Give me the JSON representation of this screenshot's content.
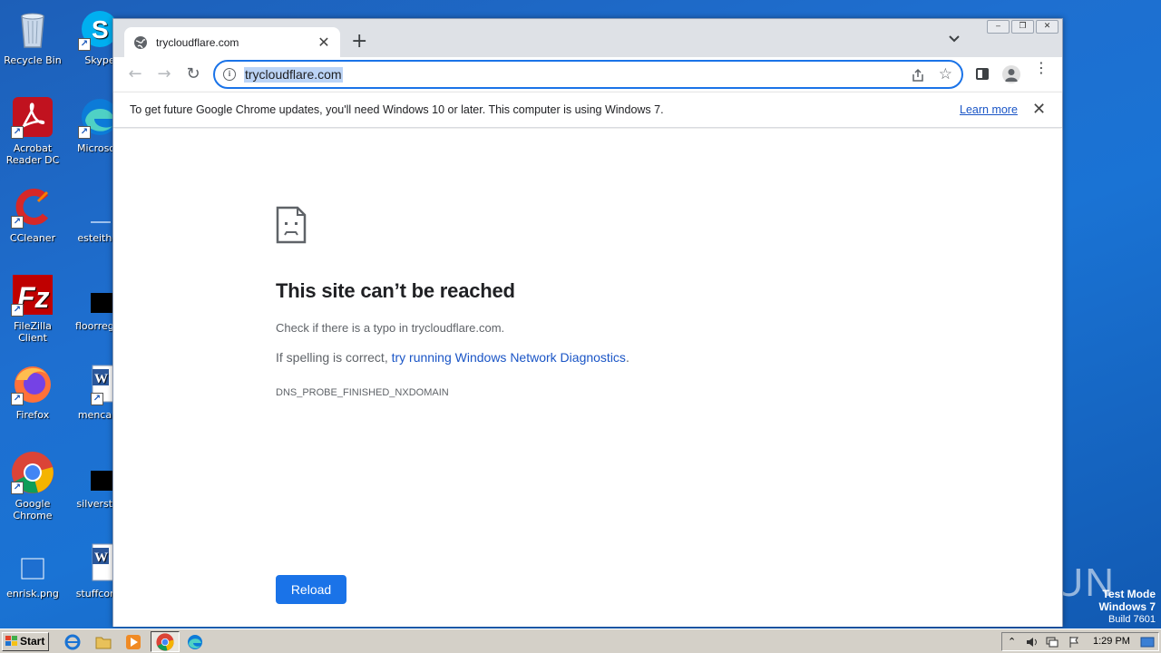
{
  "desktop": {
    "icons": [
      {
        "label": "Recycle Bin"
      },
      {
        "label": "Skype"
      },
      {
        "label": "Acrobat Reader DC"
      },
      {
        "label": "Microsoft"
      },
      {
        "label": "CCleaner"
      },
      {
        "label": "esteither"
      },
      {
        "label": "FileZilla Client"
      },
      {
        "label": "floorregar"
      },
      {
        "label": "Firefox"
      },
      {
        "label": "mencare"
      },
      {
        "label": "Google Chrome"
      },
      {
        "label": "silverstru"
      },
      {
        "label": "enrisk.png"
      },
      {
        "label": "stuffcomr"
      }
    ],
    "watermark": "ANY RUN",
    "test_mode": {
      "line1": "Test Mode",
      "line2": "Windows 7",
      "line3": "Build 7601"
    }
  },
  "browser": {
    "tab": {
      "title": "trycloudflare.com",
      "close": "✕"
    },
    "new_tab": "+",
    "window_buttons": {
      "minimize": "‒",
      "restore": "❐",
      "close": "✕"
    },
    "nav": {
      "back": "←",
      "forward": "→",
      "reload": "↻"
    },
    "address": {
      "url": "trycloudflare.com",
      "info": "i"
    },
    "star": "☆",
    "menu": "⋮",
    "infobar": {
      "message": "To get future Google Chrome updates, you'll need Windows 10 or later. This computer is using Windows 7.",
      "link": "Learn more",
      "close": "✕"
    }
  },
  "error_page": {
    "title": "This site can’t be reached",
    "line1": "Check if there is a typo in trycloudflare.com.",
    "line2_prefix": "If spelling is correct, ",
    "line2_link": "try running Windows Network Diagnostics",
    "line2_suffix": ".",
    "code": "DNS_PROBE_FINISHED_NXDOMAIN",
    "reload_button": "Reload"
  },
  "taskbar": {
    "start": "Start",
    "clock": "1:29 PM",
    "tray_arrow": "⌃"
  },
  "colors": {
    "accent": "#1a73e8",
    "link": "#1a55c6",
    "desktop": "#1a73d4",
    "taskbar": "#d4d0c8"
  }
}
